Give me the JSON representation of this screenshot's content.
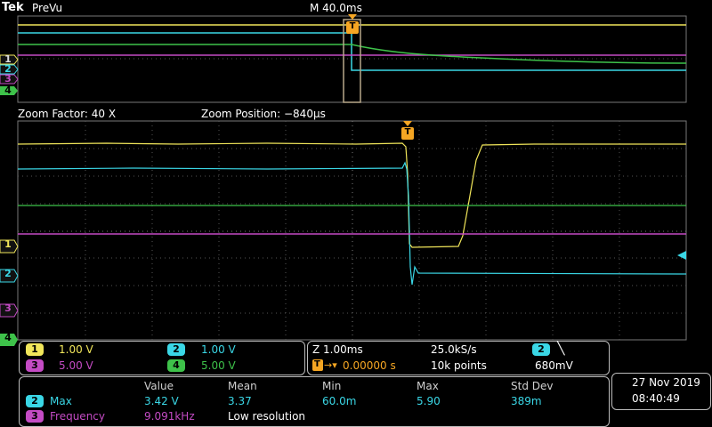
{
  "header": {
    "brand": "Tek",
    "mode": "PreVu",
    "timebase": "M 40.0ms"
  },
  "zoom": {
    "factor": "Zoom Factor: 40 X",
    "position": "Zoom Position: −840µs"
  },
  "trigger_marker": "T",
  "channels": [
    {
      "num": "1",
      "scale": "1.00 V",
      "color": "#f1e65a"
    },
    {
      "num": "2",
      "scale": "1.00 V",
      "color": "#3ad7e6"
    },
    {
      "num": "3",
      "scale": "5.00 V",
      "color": "#c44bc4"
    },
    {
      "num": "4",
      "scale": "5.00 V",
      "color": "#3ec24a"
    }
  ],
  "horizontal": {
    "zoom_scale": "Z 1.00ms",
    "sample_rate": "25.0kS/s",
    "trigger_ch": "2",
    "trigger_symbol": "╲",
    "trigger_pos": "0.00000 s",
    "record_length": "10k points",
    "trigger_level": "680mV"
  },
  "measurements": {
    "headers": [
      "Value",
      "Mean",
      "Min",
      "Max",
      "Std Dev"
    ],
    "rows": [
      {
        "ch": "2",
        "name": "Max",
        "value": "3.42 V",
        "mean": "3.37",
        "min": "60.0m",
        "max": "5.90",
        "std": "389m"
      },
      {
        "ch": "3",
        "name": "Frequency",
        "value": "9.091kHz",
        "mean": "Low resolution",
        "min": "",
        "max": "",
        "std": ""
      }
    ]
  },
  "datetime": {
    "date": "27 Nov 2019",
    "time": "08:40:49"
  }
}
